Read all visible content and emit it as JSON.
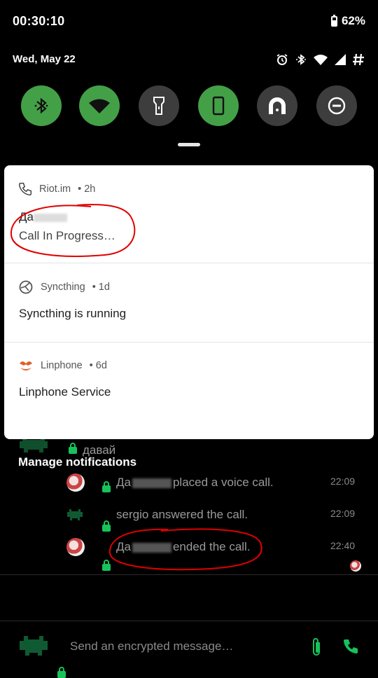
{
  "status_bar": {
    "time": "00:30:10",
    "battery": "62%",
    "battery_level": 0.62,
    "date": "Wed, May 22"
  },
  "status_icons": [
    "alarm-icon",
    "bluetooth-icon",
    "wifi-icon",
    "signal-icon",
    "hash-icon"
  ],
  "quick_settings": [
    {
      "name": "bluetooth",
      "state": "on",
      "color": "#43a047"
    },
    {
      "name": "wifi",
      "state": "on",
      "color": "#43a047"
    },
    {
      "name": "flashlight",
      "state": "off",
      "color": "#3d3d3d"
    },
    {
      "name": "auto-rotate",
      "state": "on",
      "color": "#43a047"
    },
    {
      "name": "cast",
      "state": "off",
      "color": "#3d3d3d"
    },
    {
      "name": "do-not-disturb",
      "state": "off",
      "color": "#3d3d3d"
    }
  ],
  "notifications": [
    {
      "app": "Riot.im",
      "age": "• 2h",
      "title_prefix": "Да",
      "text": "Call In Progress…",
      "icon": "phone-icon"
    },
    {
      "app": "Syncthing",
      "age": "• 1d",
      "text": "Syncthing is running",
      "icon": "syncthing-icon"
    },
    {
      "app": "Linphone",
      "age": "• 6d",
      "text": "Linphone Service",
      "icon": "linphone-icon"
    }
  ],
  "manage_label": "Manage notifications",
  "chat": {
    "partial_message": "давай",
    "messages": [
      {
        "prefix": "Да",
        "text": "placed a voice call.",
        "time": "22:09"
      },
      {
        "text": "sergio answered the call.",
        "time": "22:09"
      },
      {
        "prefix": "Да",
        "text": "ended the call.",
        "time": "22:40"
      }
    ],
    "composer_placeholder": "Send an encrypted message…"
  },
  "colors": {
    "accent_green": "#43a047",
    "annotation_red": "#e00000",
    "element_green": "#16c35a"
  }
}
